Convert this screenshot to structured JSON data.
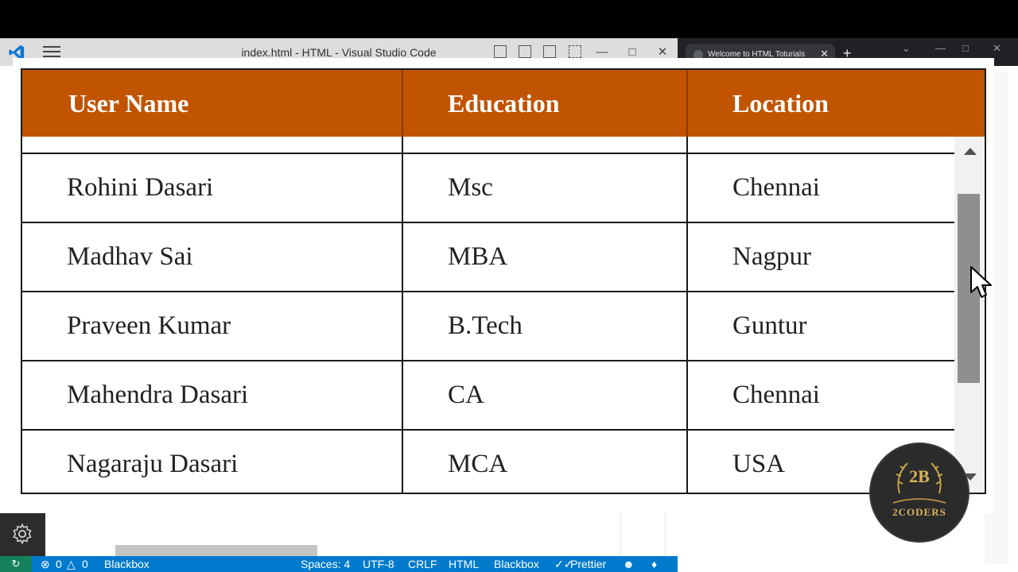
{
  "vscode": {
    "window_title": "index.html - HTML - Visual Studio Code",
    "window_controls": [
      "minimize-icon",
      "maximize-icon",
      "close-icon"
    ],
    "status": {
      "errors": "0",
      "warnings": "0",
      "left_item": "Blackbox",
      "spaces": "Spaces: 4",
      "encoding": "UTF-8",
      "eol": "CRLF",
      "language": "HTML",
      "blackbox": "Blackbox",
      "prettier": "Prettier"
    },
    "accent": "#007acc"
  },
  "browser": {
    "tab_title": "Welcome to HTML Toturials"
  },
  "table": {
    "header_color": "#c05400",
    "headers": [
      "User Name",
      "Education",
      "Location"
    ],
    "rows": [
      [
        "Rohini Dasari",
        "Msc",
        "Chennai"
      ],
      [
        "Madhav Sai",
        "MBA",
        "Nagpur"
      ],
      [
        "Praveen Kumar",
        "B.Tech",
        "Guntur"
      ],
      [
        "Mahendra Dasari",
        "CA",
        "Chennai"
      ],
      [
        "Nagaraju Dasari",
        "MCA",
        "USA"
      ]
    ]
  },
  "watermark": {
    "monogram": "2B",
    "brand": "2CODERS"
  }
}
